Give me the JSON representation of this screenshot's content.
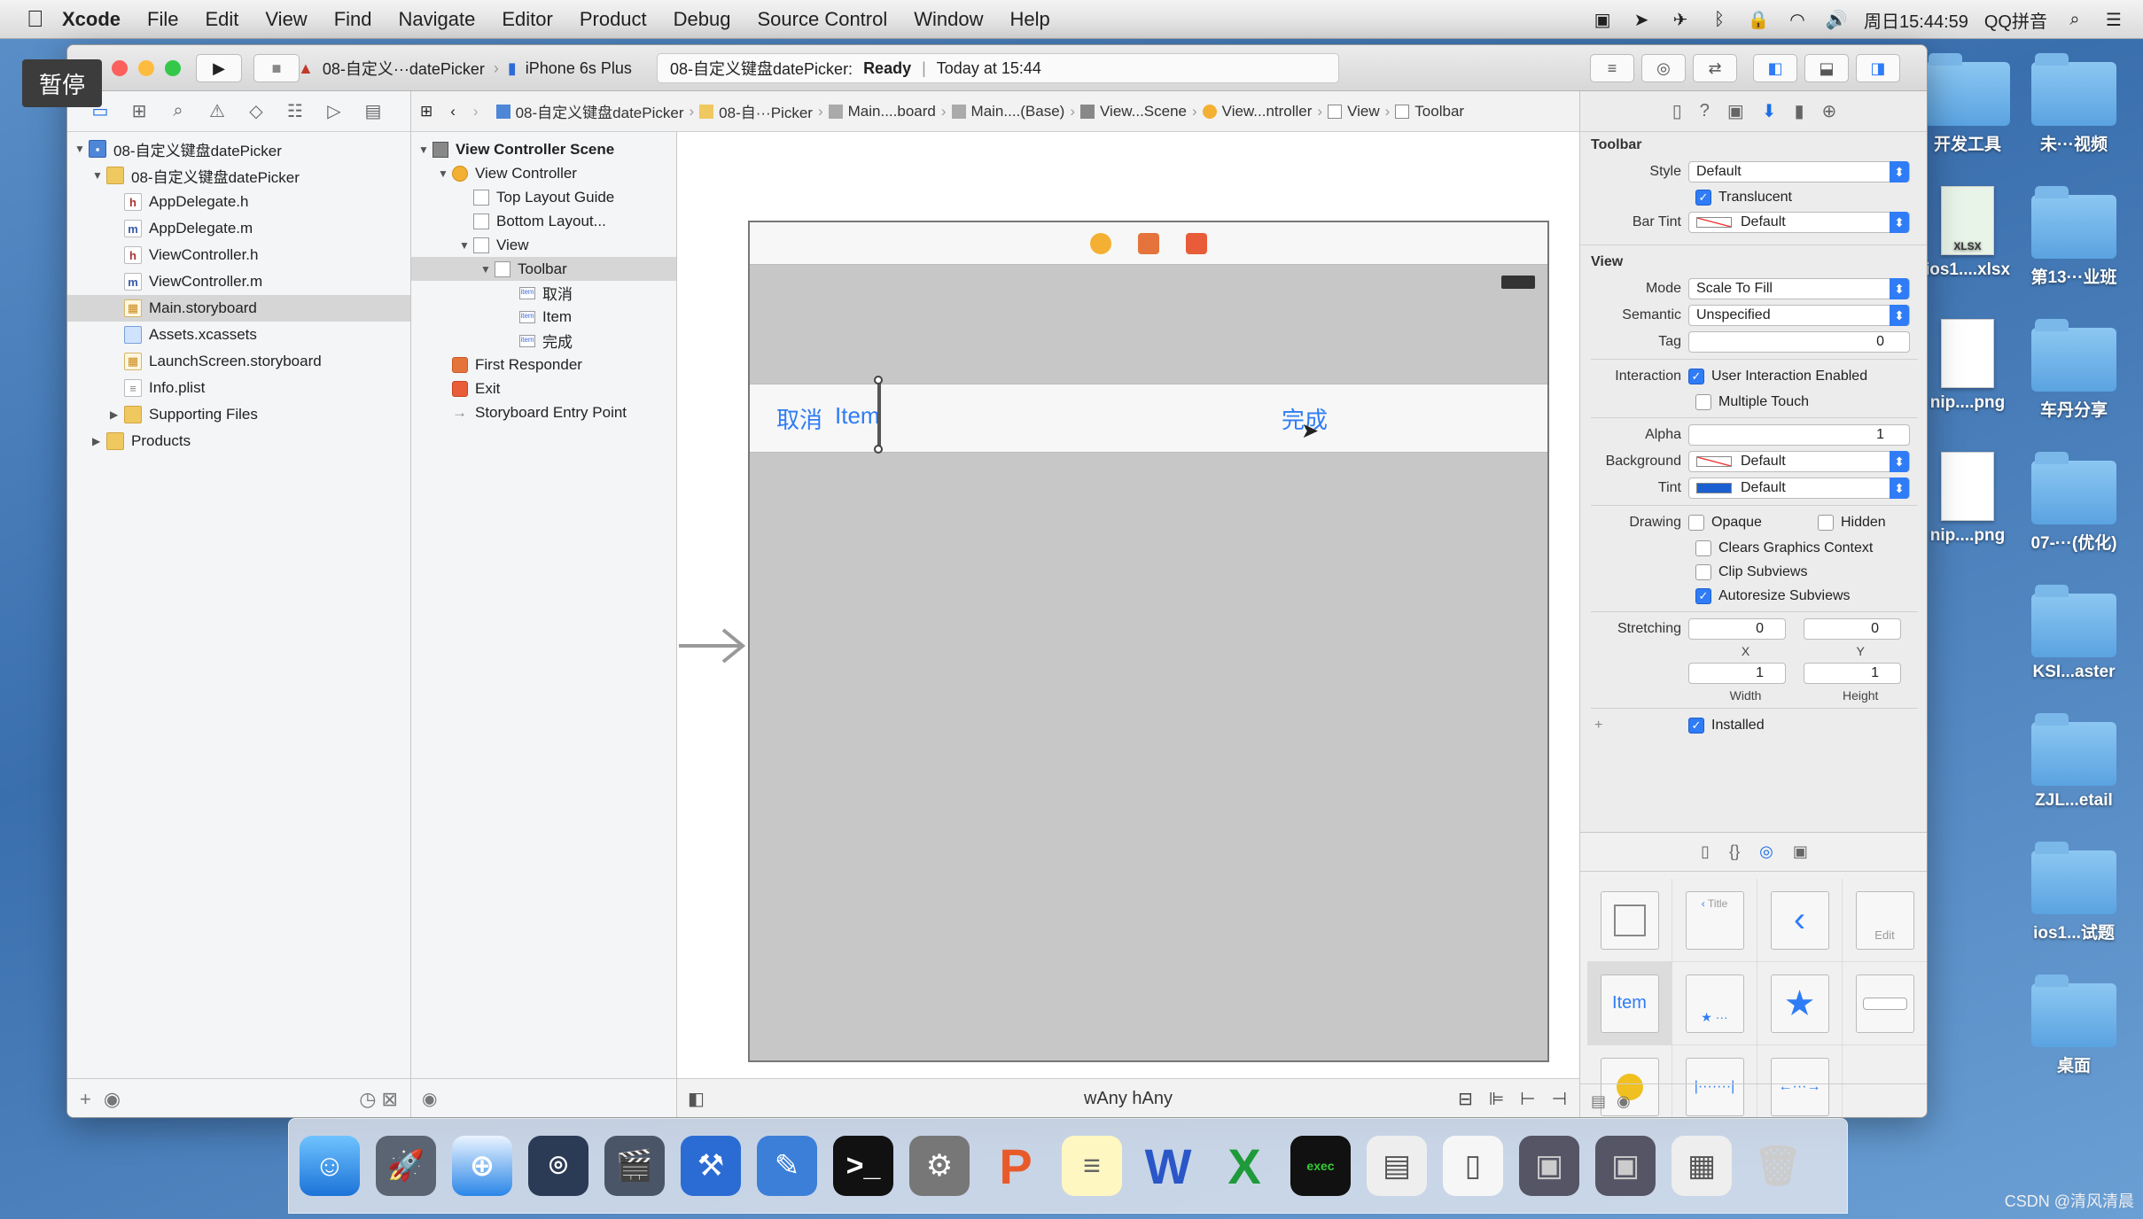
{
  "menubar": {
    "app": "Xcode",
    "items": [
      "File",
      "Edit",
      "View",
      "Find",
      "Navigate",
      "Editor",
      "Product",
      "Debug",
      "Source Control",
      "Window",
      "Help"
    ],
    "clock": "周日15:44:59",
    "input_method": "QQ拼音"
  },
  "overlay": {
    "pause_label": "暂停"
  },
  "toolbar": {
    "scheme": "08-自定义···datePicker",
    "device": "iPhone 6s Plus",
    "activity_project": "08-自定义键盘datePicker:",
    "activity_status": "Ready",
    "activity_time": "Today at 15:44"
  },
  "navigator": {
    "items": [
      {
        "label": "08-自定义键盘datePicker",
        "type": "proj",
        "indent": 0,
        "expanded": true
      },
      {
        "label": "08-自定义键盘datePicker",
        "type": "folder",
        "indent": 1,
        "expanded": true
      },
      {
        "label": "AppDelegate.h",
        "type": "h",
        "indent": 2
      },
      {
        "label": "AppDelegate.m",
        "type": "m",
        "indent": 2
      },
      {
        "label": "ViewController.h",
        "type": "h",
        "indent": 2
      },
      {
        "label": "ViewController.m",
        "type": "m",
        "indent": 2
      },
      {
        "label": "Main.storyboard",
        "type": "sb",
        "indent": 2,
        "selected": true
      },
      {
        "label": "Assets.xcassets",
        "type": "xcass",
        "indent": 2
      },
      {
        "label": "LaunchScreen.storyboard",
        "type": "sb",
        "indent": 2
      },
      {
        "label": "Info.plist",
        "type": "plist",
        "indent": 2
      },
      {
        "label": "Supporting Files",
        "type": "folder",
        "indent": 2,
        "collapsed": true
      },
      {
        "label": "Products",
        "type": "folder",
        "indent": 1,
        "collapsed": true
      }
    ]
  },
  "jumpbar": {
    "crumbs": [
      "08-自定义键盘datePicker",
      "08-自···Picker",
      "Main....board",
      "Main....(Base)",
      "View...Scene",
      "View...ntroller",
      "View",
      "Toolbar"
    ]
  },
  "outline": {
    "rows": [
      {
        "label": "View Controller Scene",
        "indent": 0,
        "icon": "scene",
        "bold": true,
        "tri": "▼"
      },
      {
        "label": "View Controller",
        "indent": 1,
        "icon": "vc",
        "tri": "▼"
      },
      {
        "label": "Top Layout Guide",
        "indent": 2,
        "icon": "box"
      },
      {
        "label": "Bottom Layout...",
        "indent": 2,
        "icon": "box"
      },
      {
        "label": "View",
        "indent": 2,
        "icon": "box",
        "tri": "▼"
      },
      {
        "label": "Toolbar",
        "indent": 3,
        "icon": "box",
        "tri": "▼",
        "selected": true
      },
      {
        "label": "取消",
        "indent": 4,
        "icon": "item"
      },
      {
        "label": "Item",
        "indent": 4,
        "icon": "item"
      },
      {
        "label": "完成",
        "indent": 4,
        "icon": "item"
      },
      {
        "label": "First Responder",
        "indent": 1,
        "icon": "fr"
      },
      {
        "label": "Exit",
        "indent": 1,
        "icon": "ex"
      },
      {
        "label": "Storyboard Entry Point",
        "indent": 1,
        "icon": "arrow"
      }
    ]
  },
  "canvas": {
    "toolbar_items": {
      "cancel": "取消",
      "item": "Item",
      "done": "完成"
    },
    "size_class": "wAny hAny"
  },
  "inspector": {
    "toolbar_section": {
      "title": "Toolbar",
      "style_label": "Style",
      "style_value": "Default",
      "translucent_label": "Translucent",
      "bartint_label": "Bar Tint",
      "bartint_value": "Default"
    },
    "view_section": {
      "title": "View",
      "mode_label": "Mode",
      "mode_value": "Scale To Fill",
      "semantic_label": "Semantic",
      "semantic_value": "Unspecified",
      "tag_label": "Tag",
      "tag_value": "0",
      "interaction_label": "Interaction",
      "user_interaction": "User Interaction Enabled",
      "multiple_touch": "Multiple Touch",
      "alpha_label": "Alpha",
      "alpha_value": "1",
      "background_label": "Background",
      "background_value": "Default",
      "tint_label": "Tint",
      "tint_value": "Default",
      "drawing_label": "Drawing",
      "opaque": "Opaque",
      "hidden": "Hidden",
      "clears": "Clears Graphics Context",
      "clip": "Clip Subviews",
      "autoresize": "Autoresize Subviews",
      "stretching_label": "Stretching",
      "stretch_x": "0",
      "stretch_y": "0",
      "x_label": "X",
      "y_label": "Y",
      "stretch_w": "1",
      "stretch_h": "1",
      "w_label": "Width",
      "h_label": "Height",
      "installed": "Installed"
    },
    "library": {
      "title_cell": "Title",
      "edit_cell": "Edit",
      "item_cell": "Item"
    }
  },
  "desktop": {
    "icons": [
      {
        "label": "开发工具",
        "kind": "folder"
      },
      {
        "label": "未···视频",
        "kind": "folder"
      },
      {
        "label": "ios1....xlsx",
        "kind": "file"
      },
      {
        "label": "第13···业班",
        "kind": "folder"
      },
      {
        "label": "nip....png",
        "kind": "file"
      },
      {
        "label": "车丹分享",
        "kind": "folder"
      },
      {
        "label": "nip....png",
        "kind": "file"
      },
      {
        "label": "07-···(优化)",
        "kind": "folder"
      },
      {
        "label": "KSI...aster",
        "kind": "folder"
      },
      {
        "label": "ZJL...etail",
        "kind": "folder"
      },
      {
        "label": "ios1...试题",
        "kind": "folder"
      },
      {
        "label": "桌面",
        "kind": "folder"
      }
    ],
    "xlsx_badge": "XLSX"
  },
  "watermark": "CSDN @清风清晨",
  "colors": {
    "accent": "#2f7cf6",
    "toolbar_item": "#2f7cf6"
  }
}
